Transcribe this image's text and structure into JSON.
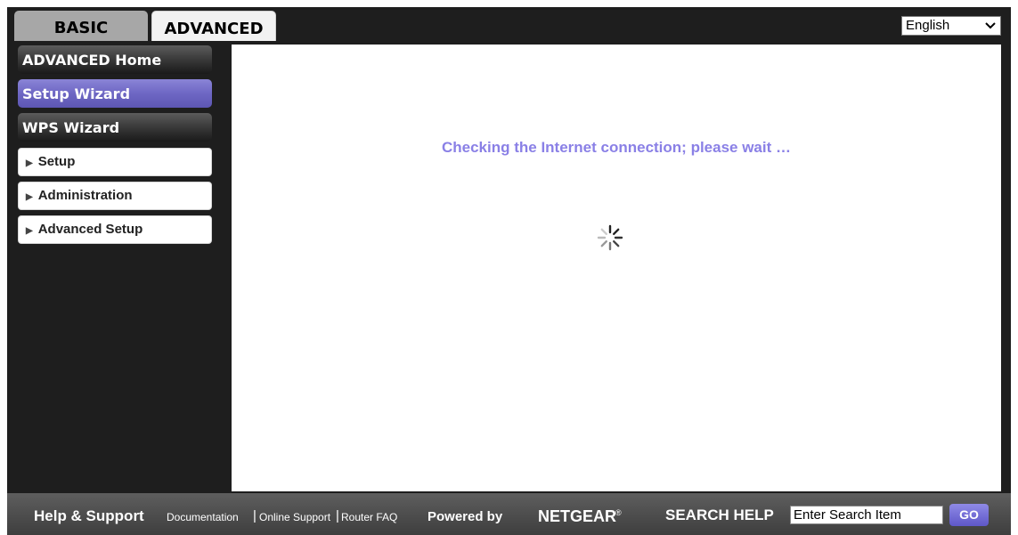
{
  "tabs": {
    "basic": "BASIC",
    "advanced": "ADVANCED"
  },
  "language": {
    "selected": "English"
  },
  "sidebar": {
    "advanced_home": "ADVANCED Home",
    "setup_wizard": "Setup Wizard",
    "wps_wizard": "WPS Wizard",
    "items": [
      {
        "label": "Setup"
      },
      {
        "label": "Administration"
      },
      {
        "label": "Advanced Setup"
      }
    ]
  },
  "main": {
    "status_text": "Checking the Internet connection; please wait …",
    "spinner_icon": "loading-spinner-icon"
  },
  "footer": {
    "help_title": "Help & Support",
    "links": [
      "Documentation",
      "Online Support",
      "Router FAQ"
    ],
    "separator": "|",
    "powered_by": "Powered by",
    "brand": "NETGEAR",
    "registered": "®",
    "search_label": "SEARCH HELP",
    "search_placeholder": "Enter Search Item",
    "go_label": "GO"
  },
  "colors": {
    "accent_purple": "#6e67c4",
    "status_text": "#8a80e6",
    "frame_dark": "#1e1e1e"
  }
}
